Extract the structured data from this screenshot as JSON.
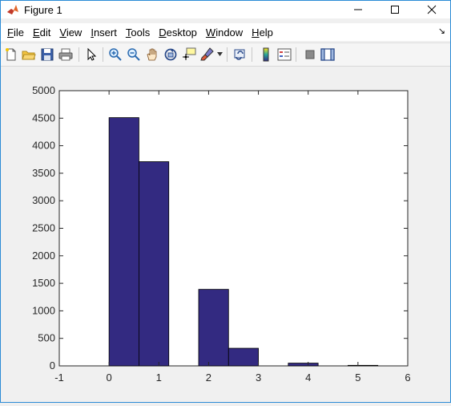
{
  "window": {
    "title": "Figure 1",
    "icon": "matlab-icon"
  },
  "menu": {
    "items": [
      {
        "key": "F",
        "rest": "ile"
      },
      {
        "key": "E",
        "rest": "dit"
      },
      {
        "key": "V",
        "rest": "iew"
      },
      {
        "key": "I",
        "rest": "nsert"
      },
      {
        "key": "T",
        "rest": "ools"
      },
      {
        "key": "D",
        "rest": "esktop"
      },
      {
        "key": "W",
        "rest": "indow"
      },
      {
        "key": "H",
        "rest": "elp"
      }
    ]
  },
  "toolbar": {
    "icons": [
      "new-figure-icon",
      "open-file-icon",
      "save-icon",
      "print-icon",
      "select-arrow-icon",
      "zoom-in-icon",
      "zoom-out-icon",
      "pan-hand-icon",
      "rotate-3d-icon",
      "data-cursor-icon",
      "brush-icon",
      "link-plot-icon",
      "colorbar-icon",
      "legend-icon",
      "hide-plot-tools-icon",
      "show-plot-tools-icon"
    ]
  },
  "chart_data": {
    "type": "bar",
    "categories": [
      "0.3",
      "0.9",
      "2.1",
      "2.7",
      "3.9",
      "5.1"
    ],
    "x": [
      0.3,
      0.9,
      2.1,
      2.7,
      3.9,
      5.1
    ],
    "bar_width": 0.6,
    "values": [
      4510,
      3710,
      1390,
      320,
      50,
      10
    ],
    "xlim": [
      -1,
      6
    ],
    "ylim": [
      0,
      5000
    ],
    "xticks": [
      -1,
      0,
      1,
      2,
      3,
      4,
      5,
      6
    ],
    "yticks": [
      0,
      500,
      1000,
      1500,
      2000,
      2500,
      3000,
      3500,
      4000,
      4500,
      5000
    ],
    "title": "",
    "xlabel": "",
    "ylabel": "",
    "grid": false,
    "bar_color": "#332a81",
    "edge_color": "#000000"
  }
}
